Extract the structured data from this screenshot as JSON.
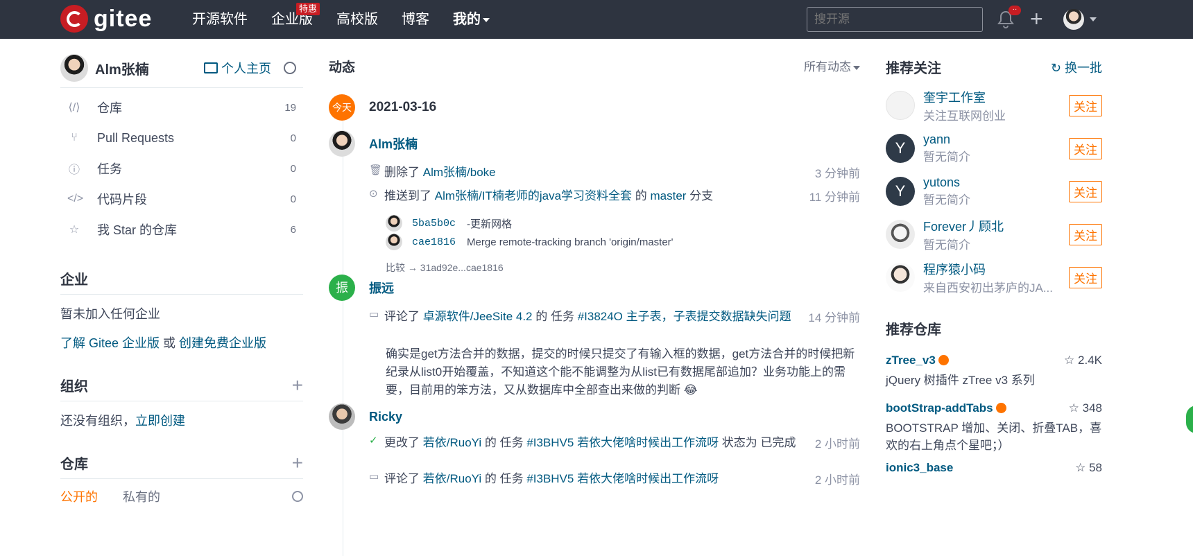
{
  "topbar": {
    "logo_text": "gitee",
    "nav": [
      {
        "label": "开源软件"
      },
      {
        "label": "企业版",
        "badge": "特惠"
      },
      {
        "label": "高校版"
      },
      {
        "label": "博客"
      },
      {
        "label": "我的"
      }
    ],
    "search_placeholder": "搜开源",
    "notification_dot": "··"
  },
  "sidebar": {
    "username": "Alm张楠",
    "homepage_label": "个人主页",
    "menu": [
      {
        "icon": "repo-icon",
        "label": "仓库",
        "count": "19"
      },
      {
        "icon": "pull-request-icon",
        "label": "Pull Requests",
        "count": "0"
      },
      {
        "icon": "issue-icon",
        "label": "任务",
        "count": "0"
      },
      {
        "icon": "code-icon",
        "label": "代码片段",
        "count": "0"
      },
      {
        "icon": "star-icon",
        "label": "我 Star 的仓库",
        "count": "6"
      }
    ],
    "enterprise": {
      "title": "企业",
      "empty": "暂未加入任何企业",
      "learn_link": "了解 Gitee 企业版",
      "or": " 或 ",
      "create_link": "创建免费企业版"
    },
    "org": {
      "title": "组织",
      "empty": "还没有组织，",
      "create_link": "立即创建"
    },
    "repos": {
      "title": "仓库",
      "tab_public": "公开的",
      "tab_private": "私有的"
    }
  },
  "feed": {
    "title": "动态",
    "filter": "所有动态",
    "today_badge": "今天",
    "date": "2021-03-16",
    "entries": [
      {
        "user": "Alm张楠",
        "actions": [
          {
            "prefix": "删除了 ",
            "link": "Alm张楠/boke",
            "suffix": "",
            "time": "3 分钟前"
          },
          {
            "prefix": "推送到了 ",
            "link": "Alm张楠/IT楠老师的java学习资料全套",
            "mid": " 的 ",
            "link2": "master",
            "suffix": " 分支",
            "time": "11 分钟前"
          }
        ],
        "commits": [
          {
            "sha": "5ba5b0c",
            "msg": "-更新网格"
          },
          {
            "sha": "cae1816",
            "msg": "Merge remote-tracking branch 'origin/master'"
          }
        ],
        "compare": "比较 → 31ad92e...cae1816"
      },
      {
        "user": "振远",
        "avatar_char": "振",
        "actions": [
          {
            "prefix": "评论了 ",
            "link": "卓源软件/JeeSite 4.2",
            "mid": " 的 任务 ",
            "link2": "#I3824O 主子表，子表提交数据缺失问题",
            "time": "14 分钟前"
          }
        ],
        "comment": "确实是get方法合并的数据，提交的时候只提交了有输入框的数据，get方法合并的时候把新纪录从list0开始覆盖，不知道这个能不能调整为从list已有数据尾部追加？业务功能上的需要，目前用的笨方法，又从数据库中全部查出来做的判断 😂"
      },
      {
        "user": "Ricky",
        "actions": [
          {
            "prefix": "更改了 ",
            "link": "若依/RuoYi",
            "mid": " 的 任务 ",
            "link2": "#I3BHV5 若依大佬啥时候出工作流呀",
            "suffix": " 状态为 已完成",
            "time": "2 小时前"
          },
          {
            "prefix": "评论了 ",
            "link": "若依/RuoYi",
            "mid": " 的 任务 ",
            "link2": "#I3BHV5 若依大佬啥时候出工作流呀",
            "time": "2 小时前"
          }
        ]
      }
    ]
  },
  "recommend_users": {
    "title": "推荐关注",
    "refresh": "换一批",
    "follow_label": "关注",
    "items": [
      {
        "name": "奎宇工作室",
        "desc": "关注互联网创业",
        "avatar_char": ""
      },
      {
        "name": "yann",
        "desc": "暂无简介",
        "avatar_char": "Y"
      },
      {
        "name": "yutons",
        "desc": "暂无简介",
        "avatar_char": "Y"
      },
      {
        "name": "Forever丿顾北",
        "desc": "暂无简介",
        "avatar_char": ""
      },
      {
        "name": "程序猿小码",
        "desc": "来自西安初出茅庐的JA...",
        "avatar_char": ""
      }
    ]
  },
  "recommend_repos": {
    "title": "推荐仓库",
    "items": [
      {
        "name": "zTree_v3",
        "stars": "2.4K",
        "desc": "jQuery 树插件 zTree v3 系列"
      },
      {
        "name": "bootStrap-addTabs",
        "stars": "348",
        "desc": "BOOTSTRAP 增加、关闭、折叠TAB，喜欢的右上角点个星吧；）"
      },
      {
        "name": "ionic3_base",
        "stars": "58",
        "desc": ""
      }
    ]
  },
  "colors": {
    "topbar": "#2e3440",
    "brand": "#c71d23",
    "accent": "#fe7300",
    "link": "#005980"
  }
}
